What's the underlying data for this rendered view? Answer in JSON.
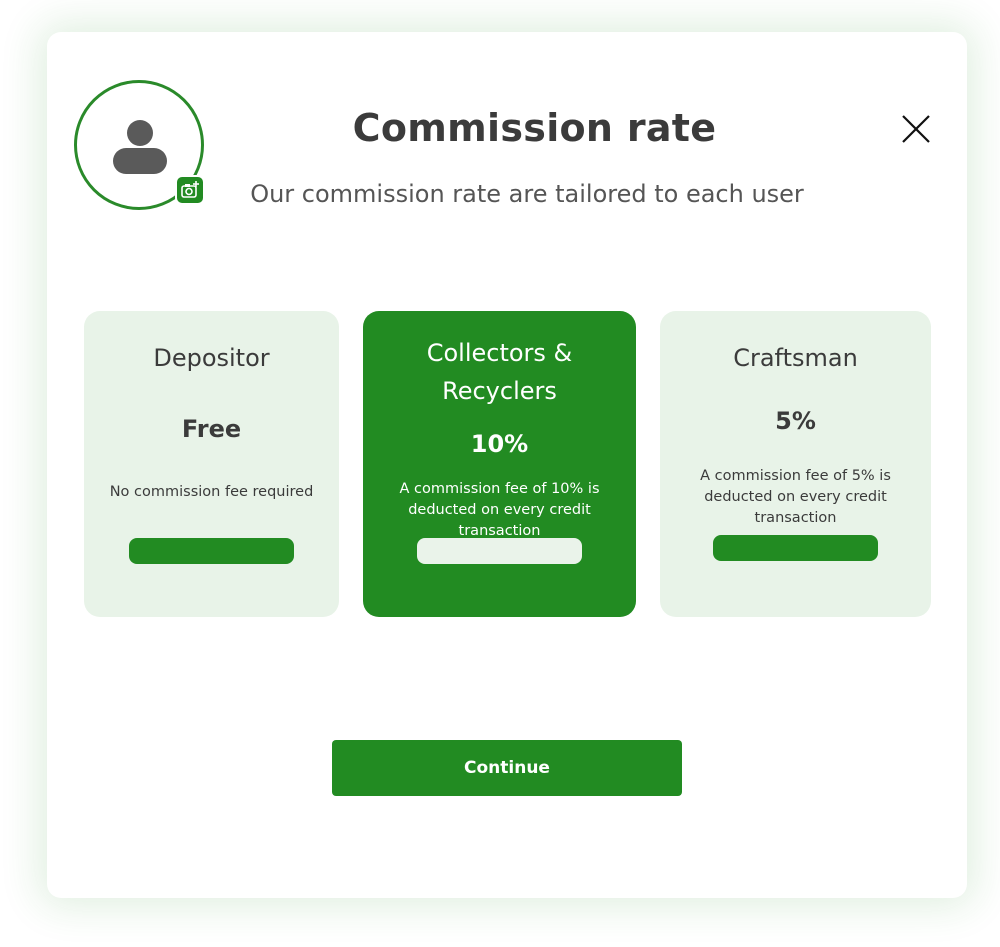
{
  "header": {
    "title": "Commission rate",
    "subtitle": "Our commission rate are tailored to each user"
  },
  "icons": {
    "avatar": "user-avatar-icon",
    "camera": "camera-plus-icon",
    "close": "close-icon"
  },
  "plans": [
    {
      "name": "Depositor",
      "price": "Free",
      "description": "No commission fee required",
      "selected": false
    },
    {
      "name": "Collectors & Recyclers",
      "price": "10%",
      "description": "A commission fee of 10% is deducted on every credit transaction",
      "selected": true
    },
    {
      "name": "Craftsman",
      "price": "5%",
      "description": "A commission fee of 5% is deducted on every credit transaction",
      "selected": false
    }
  ],
  "actions": {
    "continue_label": "Continue"
  },
  "colors": {
    "brand": "#228b22",
    "card_bg": "#e8f3e8",
    "text": "#3b3b3b"
  }
}
